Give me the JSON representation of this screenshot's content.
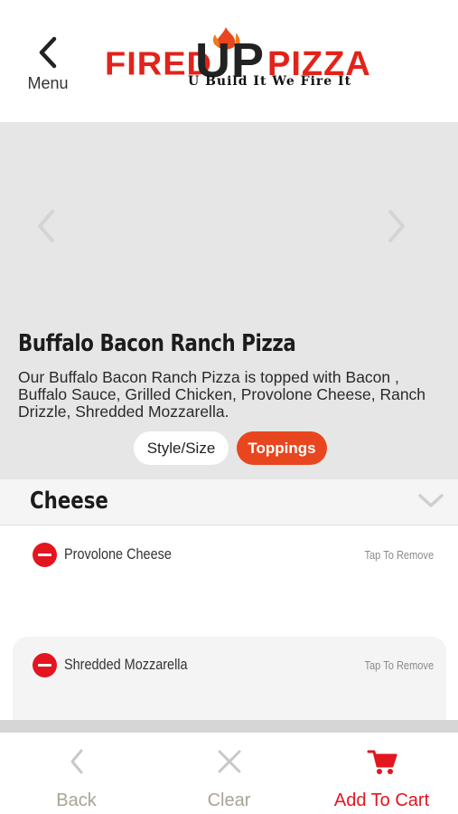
{
  "header": {
    "back_label": "Menu",
    "logo": {
      "word1": "FIRED",
      "word2": "UP",
      "word3": "PIZZA",
      "tagline": "U Build It We Fire It"
    }
  },
  "product": {
    "title": "Buffalo Bacon Ranch Pizza",
    "description": "Our Buffalo Bacon Ranch Pizza is topped with Bacon , Buffalo Sauce, Grilled Chicken, Provolone Cheese, Ranch Drizzle, Shredded Mozzarella."
  },
  "tabs": [
    {
      "label": "Style/Size",
      "active": false
    },
    {
      "label": "Toppings",
      "active": true
    }
  ],
  "section": {
    "name": "Cheese",
    "expanded": false
  },
  "toppings": [
    {
      "name": "Provolone Cheese",
      "action": "Tap To Remove"
    },
    {
      "name": "Shredded Mozzarella",
      "action": "Tap To Remove"
    }
  ],
  "bottom_bar": {
    "back": "Back",
    "clear": "Clear",
    "add_to_cart": "Add To Cart"
  },
  "colors": {
    "brand_red": "#e3151f",
    "tab_active": "#e8461e",
    "muted": "#a9a495"
  }
}
